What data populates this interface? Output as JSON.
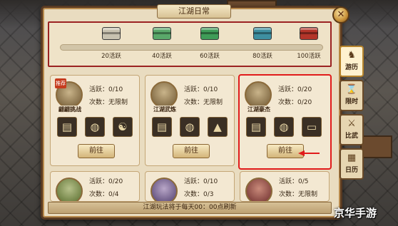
{
  "window": {
    "title": "江湖日常",
    "close_glyph": "✕"
  },
  "progress": {
    "fraction": 0.0,
    "milestones": [
      {
        "label": "20活跃",
        "color": "#c8c2b0"
      },
      {
        "label": "40活跃",
        "color": "#5aa86a"
      },
      {
        "label": "60活跃",
        "color": "#3f9c58"
      },
      {
        "label": "80活跃",
        "color": "#3e8fa0"
      },
      {
        "label": "100活跃",
        "color": "#b3352a"
      }
    ]
  },
  "cards": [
    {
      "name": "翩翩挑战",
      "tag": "推荐",
      "stat1": "活跃：0/10",
      "stat2": "次数：无限制",
      "rewards": [
        "book-icon",
        "silver-ore-icon",
        "yin-yang-icon"
      ],
      "button": "前往"
    },
    {
      "name": "江湖武炼",
      "stat1": "活跃：0/10",
      "stat2": "次数：无限制",
      "rewards": [
        "book-icon",
        "silver-ore-icon",
        "iron-ore-icon"
      ],
      "button": "前往"
    },
    {
      "name": "江湖豪杰",
      "stat1": "活跃：0/20",
      "stat2": "次数：0/20",
      "rewards": [
        "book-icon",
        "silver-ore-icon",
        "scroll-icon"
      ],
      "button": "前往"
    },
    {
      "name": "",
      "stat1": "活跃：0/20",
      "stat2": "次数：0/4"
    },
    {
      "name": "",
      "stat1": "活跃：0/10",
      "stat2": "次数：0/3"
    },
    {
      "name": "",
      "stat1": "活跃：0/5",
      "stat2": "次数：无限制"
    }
  ],
  "notice": "江湖玩法将于每天00：00点刷新",
  "side_tabs": [
    {
      "label": "游历",
      "icon": "horse-icon",
      "glyph": "♞"
    },
    {
      "label": "限时",
      "icon": "hourglass-icon",
      "glyph": "⌛"
    },
    {
      "label": "比武",
      "icon": "swords-icon",
      "glyph": "⚔"
    },
    {
      "label": "日历",
      "icon": "calendar-icon",
      "glyph": "▦"
    }
  ],
  "watermark": "京华手游",
  "colors": {
    "highlight": "#e11b1b",
    "panel": "#e9dcc0"
  }
}
